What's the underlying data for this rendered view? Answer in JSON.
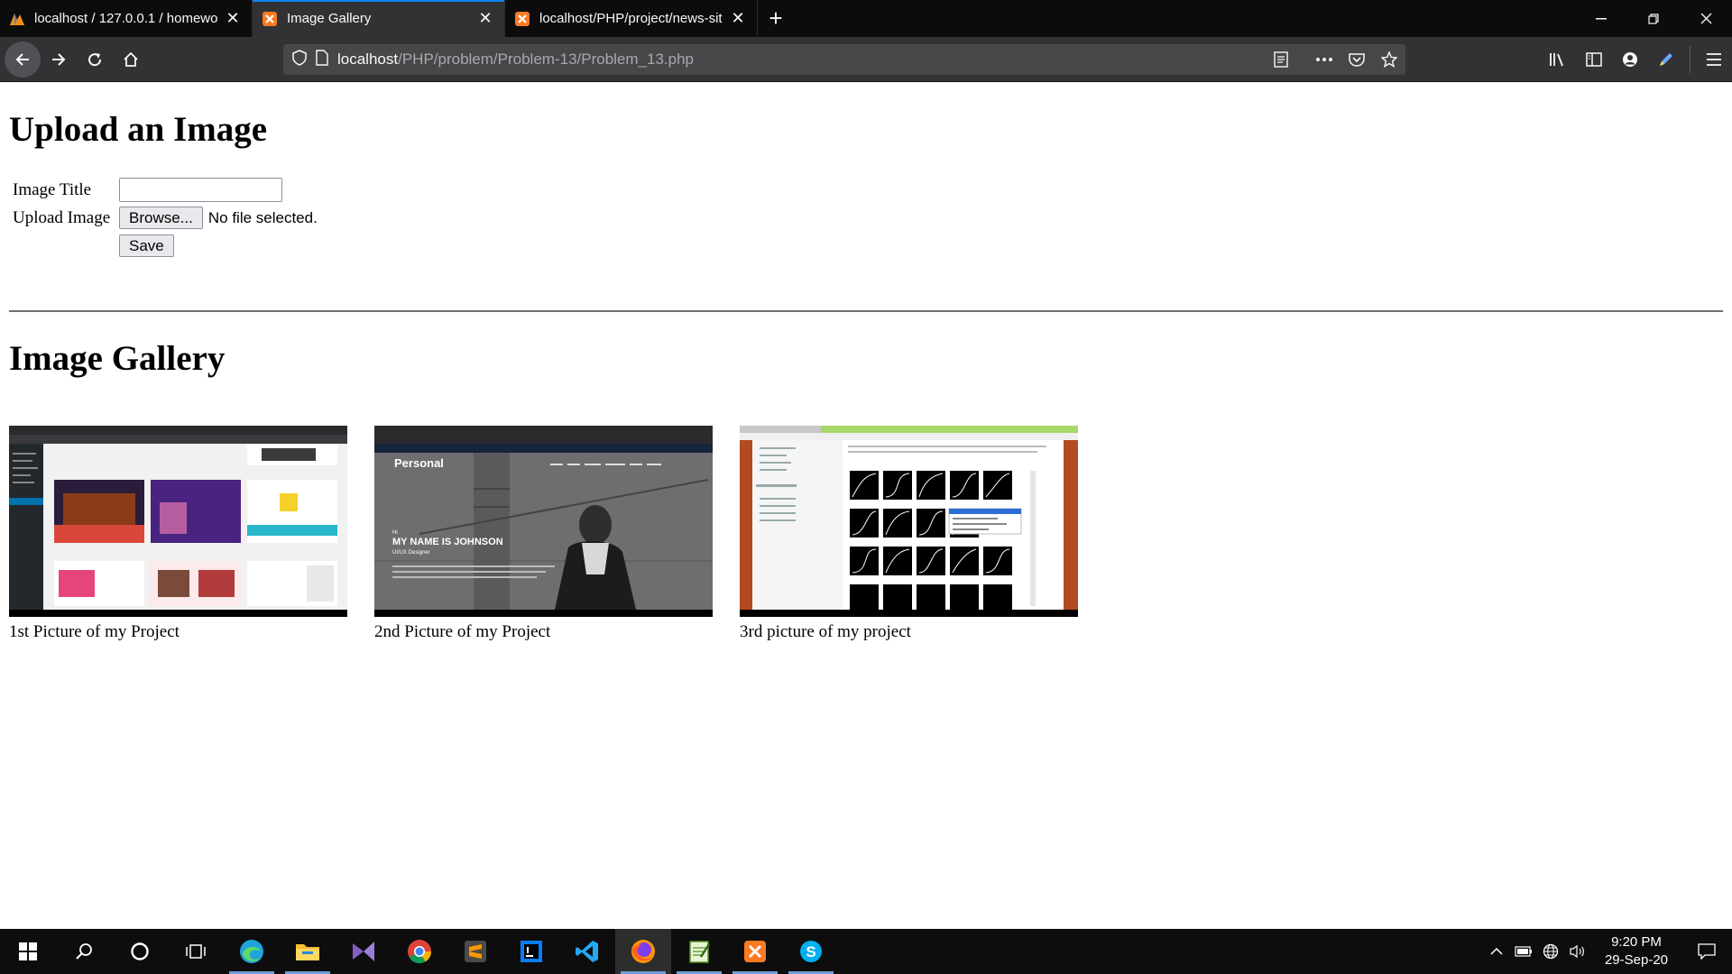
{
  "browser": {
    "tabs": [
      {
        "title": "localhost / 127.0.0.1 / homewo",
        "icon": "phpmyadmin-icon",
        "active": false
      },
      {
        "title": "Image Gallery",
        "icon": "xampp-icon",
        "active": true
      },
      {
        "title": "localhost/PHP/project/news-sit",
        "icon": "xampp-icon",
        "active": false
      }
    ],
    "new_tab_symbol": "+",
    "url": {
      "host": "localhost",
      "path": "/PHP/problem/Problem-13/Problem_13.php"
    }
  },
  "page": {
    "upload_heading": "Upload an Image",
    "form": {
      "title_label": "Image Title",
      "title_value": "",
      "upload_label": "Upload Image",
      "browse_label": "Browse...",
      "file_status": "No file selected.",
      "save_label": "Save"
    },
    "gallery_heading": "Image Gallery",
    "gallery": [
      {
        "caption": "1st Picture of my Project",
        "thumb": "admin-dashboard-screenshot"
      },
      {
        "caption": "2nd Picture of my Project",
        "thumb": "portfolio-site-screenshot"
      },
      {
        "caption": "3rd picture of my project",
        "thumb": "jquery-easing-screenshot"
      }
    ],
    "portfolio": {
      "brand": "Personal",
      "hi": "Hi",
      "headline": "MY NAME IS JOHNSON",
      "role": "UI/UX Designer"
    }
  },
  "taskbar": {
    "apps": [
      "windows-start-icon",
      "search-icon",
      "cortana-icon",
      "task-view-icon",
      "edge-icon",
      "file-explorer-icon",
      "visual-studio-icon",
      "chrome-icon",
      "sublime-text-icon",
      "intellij-icon",
      "vscode-icon",
      "firefox-icon",
      "notepad-icon",
      "xampp-icon",
      "skype-icon"
    ],
    "time": "9:20 PM",
    "date": "29-Sep-20"
  },
  "colors": {
    "accent": "#0a84ff",
    "chrome_dark": "#0c0c0d",
    "toolbar": "#323234",
    "xampp": "#fb7a24"
  }
}
